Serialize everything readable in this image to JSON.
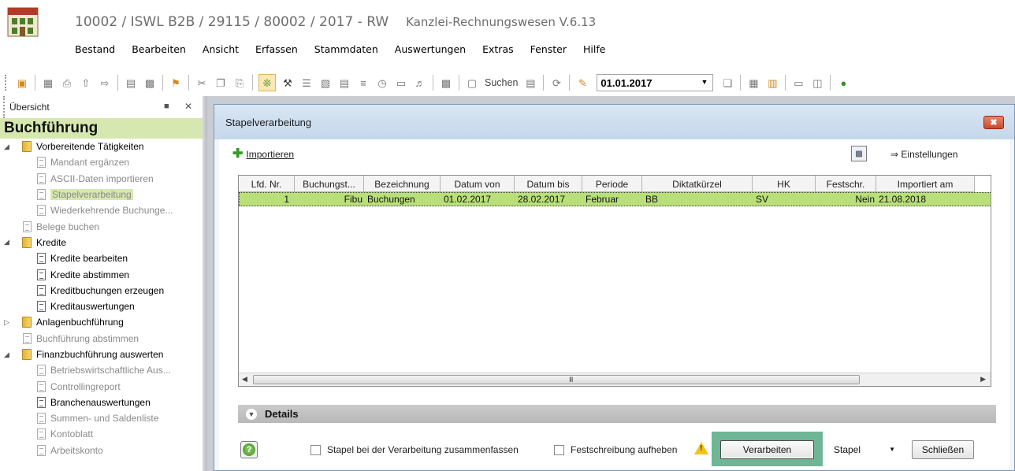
{
  "app": {
    "title": "10002 / ISWL B2B / 29115 / 80002 / 2017 - RW",
    "subtitle": "Kanzlei-Rechnungswesen V.6.13"
  },
  "menu": [
    "Bestand",
    "Bearbeiten",
    "Ansicht",
    "Erfassen",
    "Stammdaten",
    "Auswertungen",
    "Extras",
    "Fenster",
    "Hilfe"
  ],
  "toolbar": {
    "search_label": "Suchen",
    "date_value": "01.01.2017"
  },
  "left_panel": {
    "header": "Übersicht",
    "banner": "Buchführung",
    "items": [
      {
        "label": "Vorbereitende Tätigkeiten",
        "type": "folder",
        "expand": "open"
      },
      {
        "label": "Mandant ergänzen",
        "type": "doc",
        "muted": true
      },
      {
        "label": "ASCII-Daten importieren",
        "type": "doc",
        "muted": true
      },
      {
        "label": "Stapelverarbeitung",
        "type": "doc",
        "muted": true,
        "selected": true
      },
      {
        "label": "Wiederkehrende Buchunge...",
        "type": "doc",
        "muted": true
      },
      {
        "label": "Belege buchen",
        "type": "doc",
        "muted": true
      },
      {
        "label": "Kredite",
        "type": "folder",
        "expand": "open"
      },
      {
        "label": "Kredite bearbeiten",
        "type": "doc"
      },
      {
        "label": "Kredite abstimmen",
        "type": "doc"
      },
      {
        "label": "Kreditbuchungen erzeugen",
        "type": "doc"
      },
      {
        "label": "Kreditauswertungen",
        "type": "doc"
      },
      {
        "label": "Anlagenbuchführung",
        "type": "folder",
        "expand": "closed"
      },
      {
        "label": "Buchführung abstimmen",
        "type": "doc",
        "muted": true
      },
      {
        "label": "Finanzbuchführung auswerten",
        "type": "folder",
        "expand": "open"
      },
      {
        "label": "Betriebswirtschaftliche Aus...",
        "type": "doc",
        "muted": true
      },
      {
        "label": "Controllingreport",
        "type": "doc",
        "muted": true
      },
      {
        "label": "Branchenauswertungen",
        "type": "doc"
      },
      {
        "label": "Summen- und Saldenliste",
        "type": "doc",
        "muted": true
      },
      {
        "label": "Kontoblatt",
        "type": "doc",
        "muted": true
      },
      {
        "label": "Arbeitskonto",
        "type": "doc",
        "muted": true
      }
    ]
  },
  "dialog": {
    "title": "Stapelverarbeitung",
    "import_label": "Importieren",
    "settings_label": "Einstellungen",
    "columns": [
      "Lfd. Nr.",
      "Buchungst...",
      "Bezeichnung",
      "Datum von",
      "Datum bis",
      "Periode",
      "Diktatkürzel",
      "HK",
      "Festschr.",
      "Importiert am"
    ],
    "rows": [
      [
        "1",
        "Fibu",
        "Buchungen",
        "01.02.2017",
        "28.02.2017",
        "Februar",
        "BB",
        "SV",
        "Nein",
        "21.08.2018"
      ]
    ],
    "details_label": "Details",
    "checkbox_combine": "Stapel bei der Verarbeitung zusammenfassen",
    "checkbox_unlock": "Festschreibung aufheben",
    "btn_process": "Verarbeiten",
    "btn_batch": "Stapel",
    "btn_close": "Schließen"
  },
  "colors": {
    "accent_green": "#d6e8b0",
    "row_highlight": "#b8df7a",
    "focus_outline": "#6fb596"
  }
}
